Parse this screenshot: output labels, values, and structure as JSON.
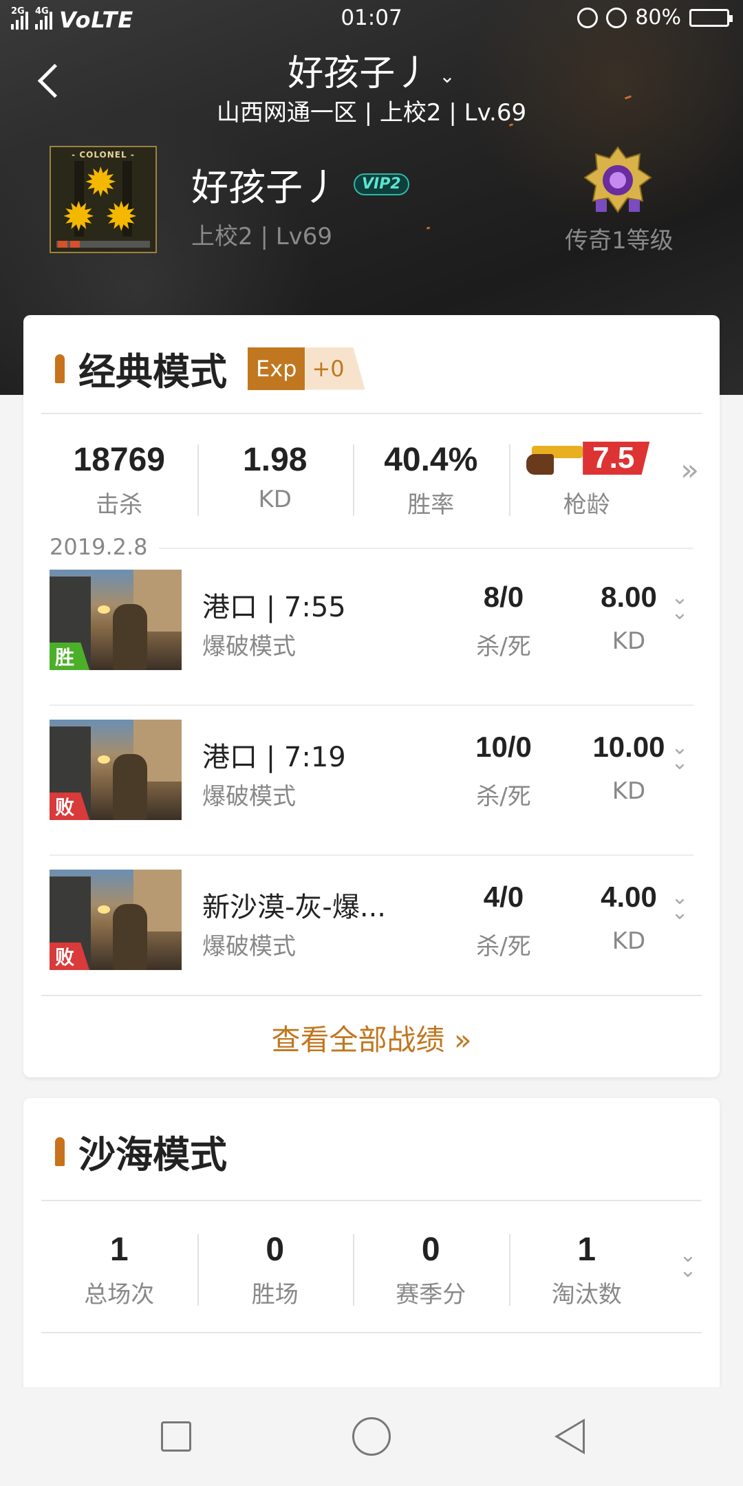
{
  "status_bar": {
    "signal_1_label": "2G",
    "signal_2_label": "4G",
    "volte": "VoLTE",
    "time": "01:07",
    "battery": "80%",
    "battery_level": 0.8,
    "icons": [
      "lock-rotation-icon",
      "alarm-icon",
      "battery-icon"
    ]
  },
  "header": {
    "title": "好孩子丿",
    "title_chevron": "⌄",
    "subtitle": "山西网通一区 | 上校2 | Lv.69"
  },
  "profile": {
    "badge_text": "- COLONEL -",
    "name": "好孩子丿",
    "vip": "VIP2",
    "rank_line": "上校2 | Lv69",
    "legend_level": "传奇1等级"
  },
  "classic": {
    "title": "经典模式",
    "exp_label": "Exp",
    "exp_value": "+0",
    "stats": [
      {
        "value": "18769",
        "label": "击杀"
      },
      {
        "value": "1.98",
        "label": "KD"
      },
      {
        "value": "40.4%",
        "label": "胜率"
      }
    ],
    "gun_age": {
      "value": "7.5",
      "label": "枪龄"
    },
    "date": "2019.2.8",
    "matches": [
      {
        "result": "胜",
        "result_type": "win",
        "map": "港口 | 7:55",
        "mode": "爆破模式",
        "kd_count": "8/0",
        "kd_count_label": "杀/死",
        "kd": "8.00",
        "kd_label": "KD"
      },
      {
        "result": "败",
        "result_type": "lose",
        "map": "港口 | 7:19",
        "mode": "爆破模式",
        "kd_count": "10/0",
        "kd_count_label": "杀/死",
        "kd": "10.00",
        "kd_label": "KD"
      },
      {
        "result": "败",
        "result_type": "lose",
        "map": "新沙漠-灰-爆...",
        "mode": "爆破模式",
        "kd_count": "4/0",
        "kd_count_label": "杀/死",
        "kd": "4.00",
        "kd_label": "KD"
      }
    ],
    "view_all": "查看全部战绩",
    "view_all_arrow": "»"
  },
  "desert": {
    "title": "沙海模式",
    "stats": [
      {
        "value": "1",
        "label": "总场次"
      },
      {
        "value": "0",
        "label": "胜场"
      },
      {
        "value": "0",
        "label": "赛季分"
      },
      {
        "value": "1",
        "label": "淘汰数"
      }
    ]
  },
  "colors": {
    "accent": "#c0771f",
    "win": "#4caf2a",
    "lose": "#d93a3a",
    "vip": "#2fb8a6"
  }
}
